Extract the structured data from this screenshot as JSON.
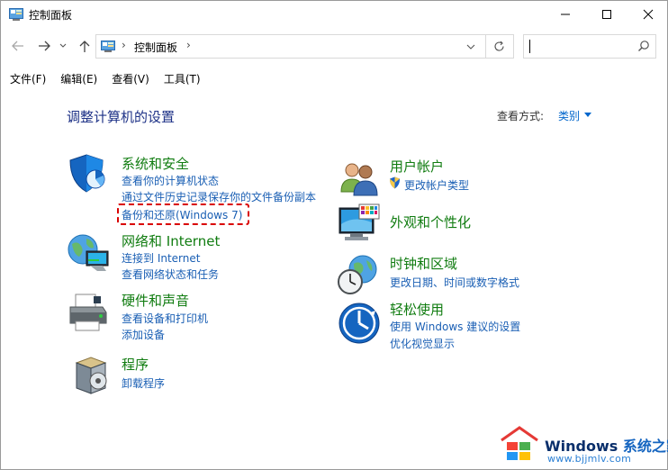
{
  "window": {
    "title": "控制面板",
    "controls": {
      "minimize": "minimize",
      "maximize": "maximize",
      "close": "close"
    }
  },
  "nav": {
    "breadcrumb_separator": "›",
    "address": "控制面板",
    "search_placeholder": ""
  },
  "menu": [
    "文件(F)",
    "编辑(E)",
    "查看(V)",
    "工具(T)"
  ],
  "main": {
    "heading": "调整计算机的设置",
    "view_by_label": "查看方式:",
    "view_by_value": "类别"
  },
  "categories": [
    {
      "title": "系统和安全",
      "icon": "shield-icon",
      "links": [
        "查看你的计算机状态",
        "通过文件历史记录保存你的文件备份副本",
        "备份和还原(Windows 7)"
      ]
    },
    {
      "title": "网络和 Internet",
      "icon": "globe-network-icon",
      "links": [
        "连接到 Internet",
        "查看网络状态和任务"
      ]
    },
    {
      "title": "硬件和声音",
      "icon": "printer-icon",
      "links": [
        "查看设备和打印机",
        "添加设备"
      ]
    },
    {
      "title": "程序",
      "icon": "programs-icon",
      "links": [
        "卸载程序"
      ]
    },
    {
      "title": "用户帐户",
      "icon": "users-icon",
      "links": [
        "更改帐户类型"
      ]
    },
    {
      "title": "外观和个性化",
      "icon": "monitor-palette-icon",
      "links": []
    },
    {
      "title": "时钟和区域",
      "icon": "clock-globe-icon",
      "links": [
        "更改日期、时间或数字格式"
      ]
    },
    {
      "title": "轻松使用",
      "icon": "ease-of-access-icon",
      "links": [
        "使用 Windows 建议的设置",
        "优化视觉显示"
      ]
    }
  ],
  "watermark": {
    "brand": "Windows",
    "brand_cn": "系统之家",
    "url": "www.bjjmlv.com"
  },
  "colors": {
    "category_title": "#107c10",
    "link": "#1a5fb4",
    "heading": "#1e3287",
    "highlight": "#d90000"
  }
}
